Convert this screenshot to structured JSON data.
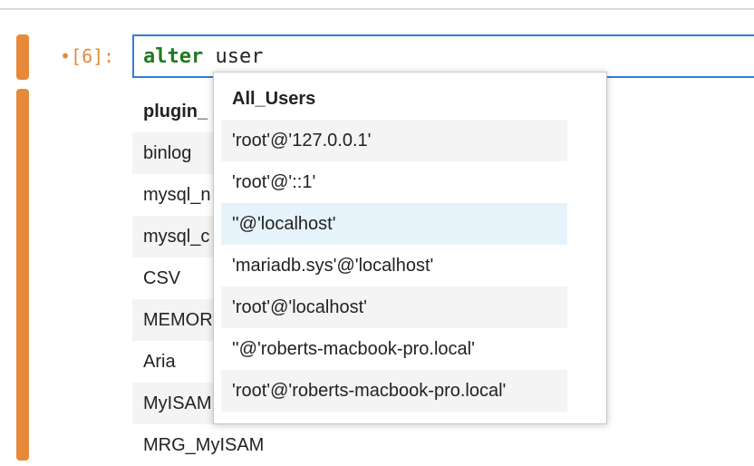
{
  "cell": {
    "prompt": "•[6]:",
    "code_keyword": "alter",
    "code_rest": " user"
  },
  "output_table": {
    "header": "plugin_",
    "rows": [
      "binlog",
      "mysql_n",
      "mysql_c",
      "CSV",
      "MEMOR",
      "Aria",
      "MyISAM",
      "MRG_MyISAM"
    ]
  },
  "autocomplete": {
    "title": "All_Users",
    "items": [
      "'root'@'127.0.0.1'",
      "'root'@'::1'",
      "''@'localhost'",
      "'mariadb.sys'@'localhost'",
      "'root'@'localhost'",
      "''@'roberts-macbook-pro.local'",
      "'root'@'roberts-macbook-pro.local'"
    ],
    "active_index": 2
  },
  "colors": {
    "cell_marker": "#e6893a",
    "editor_border": "#2f7ed8",
    "keyword": "#1f7a1f",
    "active_item": "#e6f3fb"
  }
}
